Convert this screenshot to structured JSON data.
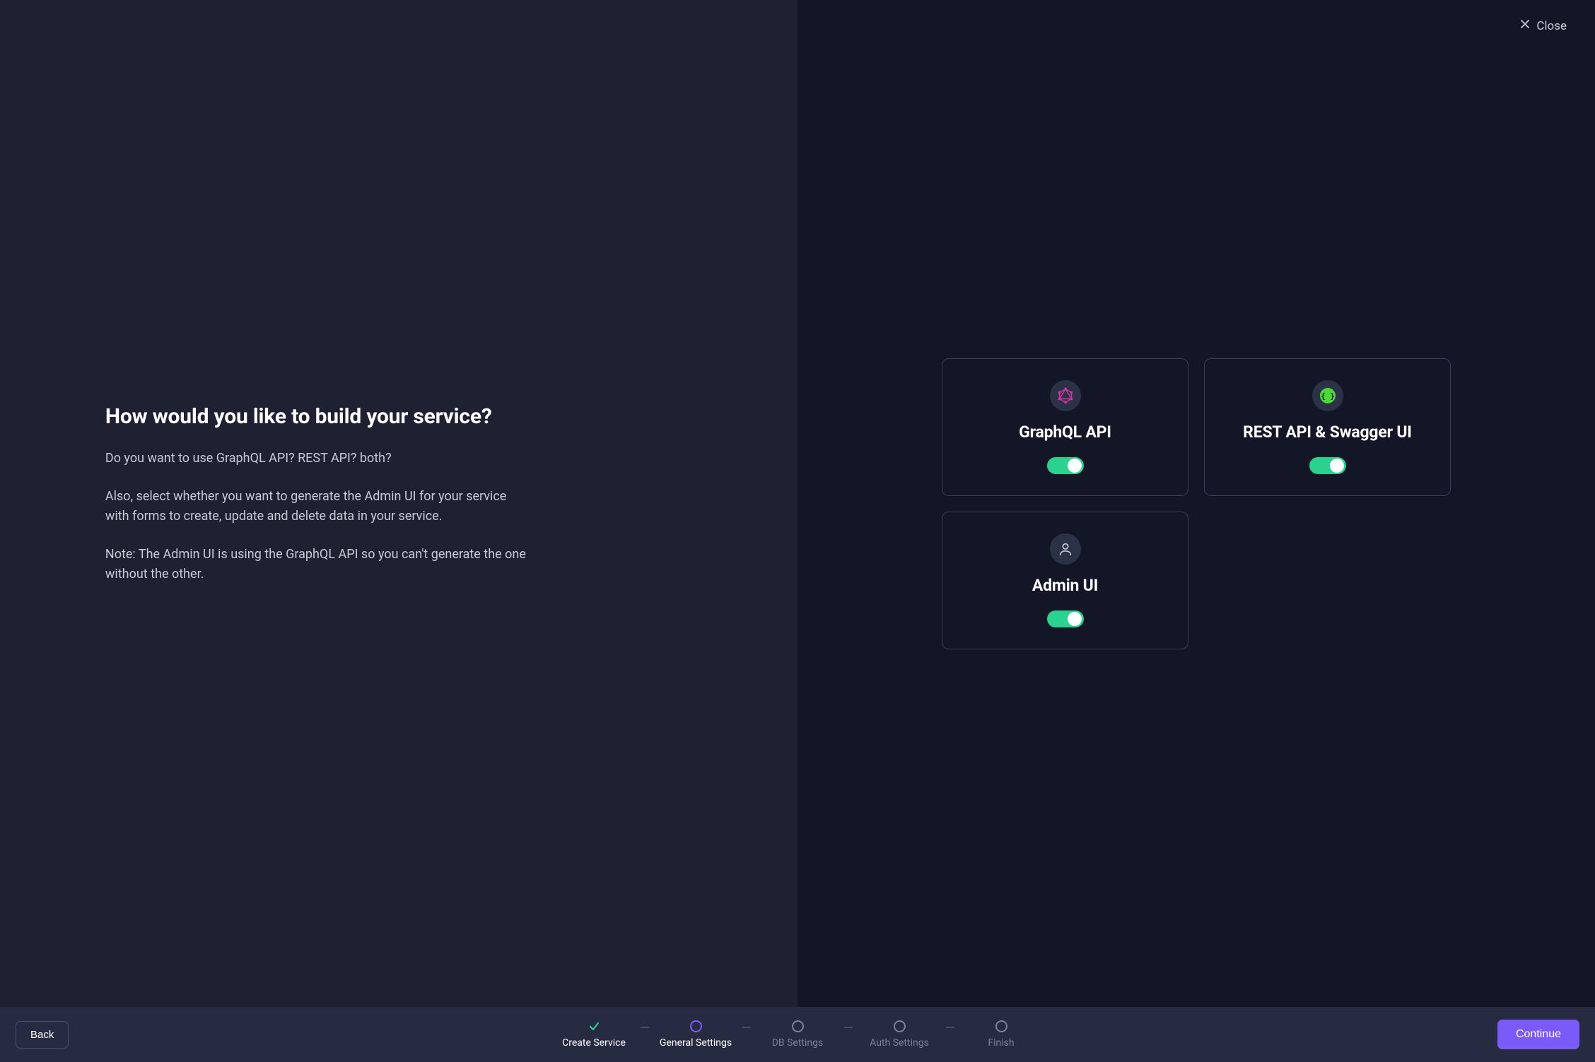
{
  "close_label": "Close",
  "left": {
    "heading": "How would you like to build your service?",
    "p1": "Do you want to use GraphQL API? REST API? both?",
    "p2": "Also, select whether you want to generate the Admin UI for your service with forms to create, update and delete data in your service.",
    "p3": "Note: The Admin UI is using the GraphQL API so you can't generate the one without the other."
  },
  "cards": {
    "graphql": {
      "title": "GraphQL API",
      "enabled": true
    },
    "rest": {
      "title": "REST API & Swagger UI",
      "enabled": true
    },
    "admin": {
      "title": "Admin UI",
      "enabled": true
    }
  },
  "footer": {
    "back": "Back",
    "continue": "Continue"
  },
  "steps": [
    {
      "label": "Create Service",
      "state": "done"
    },
    {
      "label": "General Settings",
      "state": "current"
    },
    {
      "label": "DB Settings",
      "state": "upcoming"
    },
    {
      "label": "Auth Settings",
      "state": "upcoming"
    },
    {
      "label": "Finish",
      "state": "upcoming"
    }
  ],
  "colors": {
    "accent_purple": "#7a5af8",
    "accent_green": "#2ad18f",
    "graphql_pink": "#d733a3",
    "rest_green": "#5ee640"
  }
}
